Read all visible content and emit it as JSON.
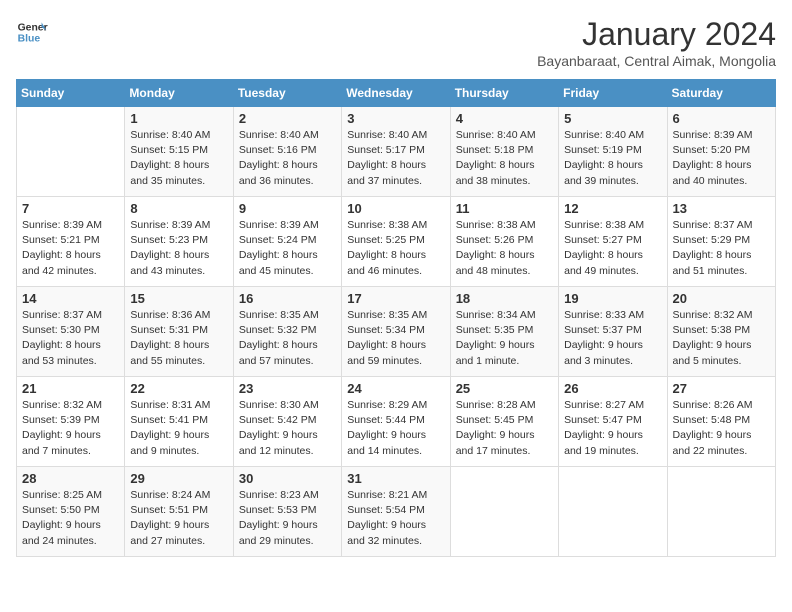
{
  "logo": {
    "line1": "General",
    "line2": "Blue"
  },
  "title": "January 2024",
  "subtitle": "Bayanbaraat, Central Aimak, Mongolia",
  "days_of_week": [
    "Sunday",
    "Monday",
    "Tuesday",
    "Wednesday",
    "Thursday",
    "Friday",
    "Saturday"
  ],
  "weeks": [
    [
      {
        "day": "",
        "sunrise": "",
        "sunset": "",
        "daylight": ""
      },
      {
        "day": "1",
        "sunrise": "Sunrise: 8:40 AM",
        "sunset": "Sunset: 5:15 PM",
        "daylight": "Daylight: 8 hours and 35 minutes."
      },
      {
        "day": "2",
        "sunrise": "Sunrise: 8:40 AM",
        "sunset": "Sunset: 5:16 PM",
        "daylight": "Daylight: 8 hours and 36 minutes."
      },
      {
        "day": "3",
        "sunrise": "Sunrise: 8:40 AM",
        "sunset": "Sunset: 5:17 PM",
        "daylight": "Daylight: 8 hours and 37 minutes."
      },
      {
        "day": "4",
        "sunrise": "Sunrise: 8:40 AM",
        "sunset": "Sunset: 5:18 PM",
        "daylight": "Daylight: 8 hours and 38 minutes."
      },
      {
        "day": "5",
        "sunrise": "Sunrise: 8:40 AM",
        "sunset": "Sunset: 5:19 PM",
        "daylight": "Daylight: 8 hours and 39 minutes."
      },
      {
        "day": "6",
        "sunrise": "Sunrise: 8:39 AM",
        "sunset": "Sunset: 5:20 PM",
        "daylight": "Daylight: 8 hours and 40 minutes."
      }
    ],
    [
      {
        "day": "7",
        "sunrise": "Sunrise: 8:39 AM",
        "sunset": "Sunset: 5:21 PM",
        "daylight": "Daylight: 8 hours and 42 minutes."
      },
      {
        "day": "8",
        "sunrise": "Sunrise: 8:39 AM",
        "sunset": "Sunset: 5:23 PM",
        "daylight": "Daylight: 8 hours and 43 minutes."
      },
      {
        "day": "9",
        "sunrise": "Sunrise: 8:39 AM",
        "sunset": "Sunset: 5:24 PM",
        "daylight": "Daylight: 8 hours and 45 minutes."
      },
      {
        "day": "10",
        "sunrise": "Sunrise: 8:38 AM",
        "sunset": "Sunset: 5:25 PM",
        "daylight": "Daylight: 8 hours and 46 minutes."
      },
      {
        "day": "11",
        "sunrise": "Sunrise: 8:38 AM",
        "sunset": "Sunset: 5:26 PM",
        "daylight": "Daylight: 8 hours and 48 minutes."
      },
      {
        "day": "12",
        "sunrise": "Sunrise: 8:38 AM",
        "sunset": "Sunset: 5:27 PM",
        "daylight": "Daylight: 8 hours and 49 minutes."
      },
      {
        "day": "13",
        "sunrise": "Sunrise: 8:37 AM",
        "sunset": "Sunset: 5:29 PM",
        "daylight": "Daylight: 8 hours and 51 minutes."
      }
    ],
    [
      {
        "day": "14",
        "sunrise": "Sunrise: 8:37 AM",
        "sunset": "Sunset: 5:30 PM",
        "daylight": "Daylight: 8 hours and 53 minutes."
      },
      {
        "day": "15",
        "sunrise": "Sunrise: 8:36 AM",
        "sunset": "Sunset: 5:31 PM",
        "daylight": "Daylight: 8 hours and 55 minutes."
      },
      {
        "day": "16",
        "sunrise": "Sunrise: 8:35 AM",
        "sunset": "Sunset: 5:32 PM",
        "daylight": "Daylight: 8 hours and 57 minutes."
      },
      {
        "day": "17",
        "sunrise": "Sunrise: 8:35 AM",
        "sunset": "Sunset: 5:34 PM",
        "daylight": "Daylight: 8 hours and 59 minutes."
      },
      {
        "day": "18",
        "sunrise": "Sunrise: 8:34 AM",
        "sunset": "Sunset: 5:35 PM",
        "daylight": "Daylight: 9 hours and 1 minute."
      },
      {
        "day": "19",
        "sunrise": "Sunrise: 8:33 AM",
        "sunset": "Sunset: 5:37 PM",
        "daylight": "Daylight: 9 hours and 3 minutes."
      },
      {
        "day": "20",
        "sunrise": "Sunrise: 8:32 AM",
        "sunset": "Sunset: 5:38 PM",
        "daylight": "Daylight: 9 hours and 5 minutes."
      }
    ],
    [
      {
        "day": "21",
        "sunrise": "Sunrise: 8:32 AM",
        "sunset": "Sunset: 5:39 PM",
        "daylight": "Daylight: 9 hours and 7 minutes."
      },
      {
        "day": "22",
        "sunrise": "Sunrise: 8:31 AM",
        "sunset": "Sunset: 5:41 PM",
        "daylight": "Daylight: 9 hours and 9 minutes."
      },
      {
        "day": "23",
        "sunrise": "Sunrise: 8:30 AM",
        "sunset": "Sunset: 5:42 PM",
        "daylight": "Daylight: 9 hours and 12 minutes."
      },
      {
        "day": "24",
        "sunrise": "Sunrise: 8:29 AM",
        "sunset": "Sunset: 5:44 PM",
        "daylight": "Daylight: 9 hours and 14 minutes."
      },
      {
        "day": "25",
        "sunrise": "Sunrise: 8:28 AM",
        "sunset": "Sunset: 5:45 PM",
        "daylight": "Daylight: 9 hours and 17 minutes."
      },
      {
        "day": "26",
        "sunrise": "Sunrise: 8:27 AM",
        "sunset": "Sunset: 5:47 PM",
        "daylight": "Daylight: 9 hours and 19 minutes."
      },
      {
        "day": "27",
        "sunrise": "Sunrise: 8:26 AM",
        "sunset": "Sunset: 5:48 PM",
        "daylight": "Daylight: 9 hours and 22 minutes."
      }
    ],
    [
      {
        "day": "28",
        "sunrise": "Sunrise: 8:25 AM",
        "sunset": "Sunset: 5:50 PM",
        "daylight": "Daylight: 9 hours and 24 minutes."
      },
      {
        "day": "29",
        "sunrise": "Sunrise: 8:24 AM",
        "sunset": "Sunset: 5:51 PM",
        "daylight": "Daylight: 9 hours and 27 minutes."
      },
      {
        "day": "30",
        "sunrise": "Sunrise: 8:23 AM",
        "sunset": "Sunset: 5:53 PM",
        "daylight": "Daylight: 9 hours and 29 minutes."
      },
      {
        "day": "31",
        "sunrise": "Sunrise: 8:21 AM",
        "sunset": "Sunset: 5:54 PM",
        "daylight": "Daylight: 9 hours and 32 minutes."
      },
      {
        "day": "",
        "sunrise": "",
        "sunset": "",
        "daylight": ""
      },
      {
        "day": "",
        "sunrise": "",
        "sunset": "",
        "daylight": ""
      },
      {
        "day": "",
        "sunrise": "",
        "sunset": "",
        "daylight": ""
      }
    ]
  ]
}
